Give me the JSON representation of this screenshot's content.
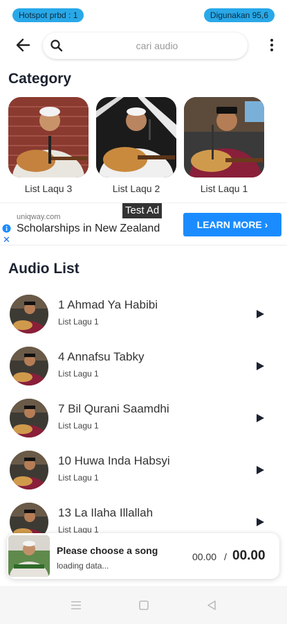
{
  "status": {
    "hotspot_text": "Hotspot prbd : 1",
    "usage_text": "Digunakan 95,6",
    "pill_color": "#29a8e8"
  },
  "topbar": {
    "back_icon": "arrow-left-icon",
    "search_placeholder": "cari audio",
    "search_icon": "search-icon",
    "more_icon": "more-vert-icon"
  },
  "category": {
    "title": "Category",
    "items": [
      {
        "label": "List Laqu 3"
      },
      {
        "label": "List Laqu 2"
      },
      {
        "label": "List Laqu 1"
      }
    ]
  },
  "ad": {
    "badge": "Test Ad",
    "domain": "uniqway.com",
    "headline": "Scholarships in New Zealand",
    "cta": "LEARN MORE",
    "cta_color": "#1a8cff"
  },
  "audio_list": {
    "title": "Audio List",
    "items": [
      {
        "title": "1 Ahmad Ya Habibi",
        "subtitle": "List Lagu 1"
      },
      {
        "title": "4 Annafsu Tabky",
        "subtitle": "List Lagu 1"
      },
      {
        "title": "7 Bil Qurani Saamdhi",
        "subtitle": "List Lagu 1"
      },
      {
        "title": "10 Huwa Inda Habsyi",
        "subtitle": "List Lagu 1"
      },
      {
        "title": "13 La Ilaha Illallah",
        "subtitle": "List Lagu 1"
      }
    ]
  },
  "player": {
    "title": "Please choose a song",
    "status": "loading data...",
    "current_time": "00.00",
    "separator": "/",
    "total_time": "00.00"
  },
  "navbar": {
    "menu_icon": "menu-icon",
    "home_icon": "square-home-icon",
    "back_icon": "triangle-back-icon"
  }
}
